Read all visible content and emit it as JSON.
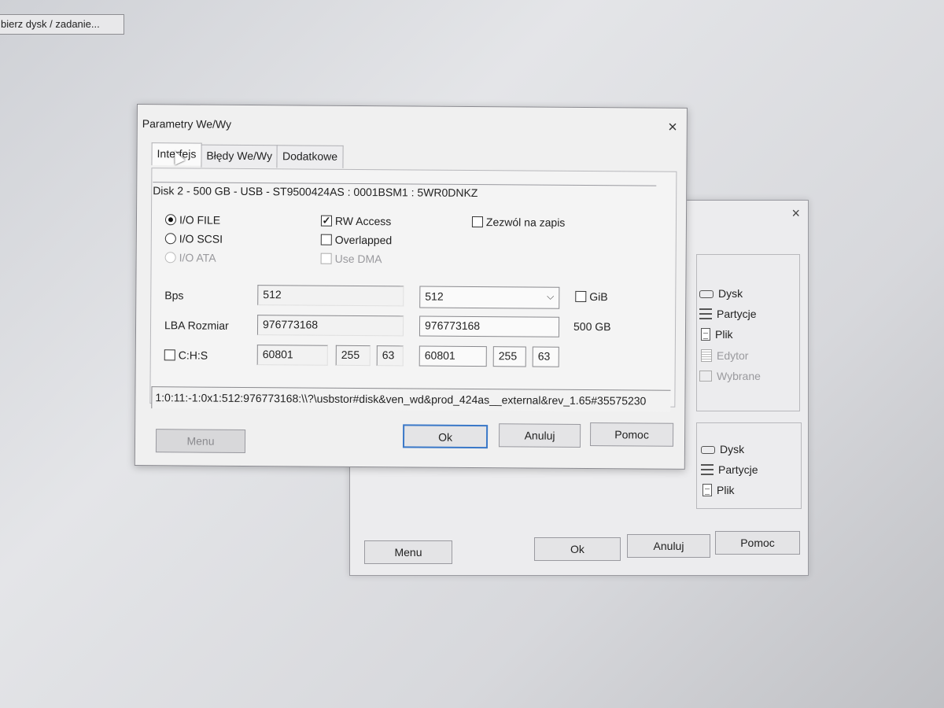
{
  "top_button": {
    "label": "bierz dysk / zadanie..."
  },
  "back_dialog": {
    "close_glyph": "×",
    "group1": [
      "Dysk",
      "Partycje",
      "Plik",
      "Edytor",
      "Wybrane"
    ],
    "group2": [
      "Dysk",
      "Partycje",
      "Plik"
    ],
    "buttons": {
      "menu": "Menu",
      "ok": "Ok",
      "cancel": "Anuluj",
      "help": "Pomoc"
    }
  },
  "dialog": {
    "title": "Parametry We/Wy",
    "close_glyph": "×",
    "tabs": [
      "Interfejs",
      "Błędy We/Wy",
      "Dodatkowe"
    ],
    "active_tab": "Interfejs",
    "disk_info": "Disk 2 - 500 GB - USB - ST9500424AS : 0001BSM1 : 5WR0DNKZ",
    "io_modes": {
      "file": "I/O FILE",
      "scsi": "I/O SCSI",
      "ata": "I/O ATA",
      "selected": "I/O FILE"
    },
    "options": {
      "rw_access": "RW Access",
      "overlapped": "Overlapped",
      "use_dma": "Use DMA",
      "allow_write": "Zezwól na zapis",
      "rw_access_checked": true
    },
    "bps": {
      "label": "Bps",
      "value": "512",
      "select_value": "512"
    },
    "gib": {
      "label": "GiB"
    },
    "lba": {
      "label": "LBA Rozmiar",
      "value": "976773168",
      "value2": "976773168",
      "size": "500 GB"
    },
    "chs": {
      "label": "C:H:S",
      "c": "60801",
      "h": "255",
      "s": "63",
      "c2": "60801",
      "h2": "255",
      "s2": "63"
    },
    "path": "1:0:11:-1:0x1:512:976773168:\\\\?\\usbstor#disk&ven_wd&prod_424as__external&rev_1.65#35575230",
    "buttons": {
      "menu": "Menu",
      "ok": "Ok",
      "cancel": "Anuluj",
      "help": "Pomoc"
    },
    "check_glyph": "✓"
  }
}
